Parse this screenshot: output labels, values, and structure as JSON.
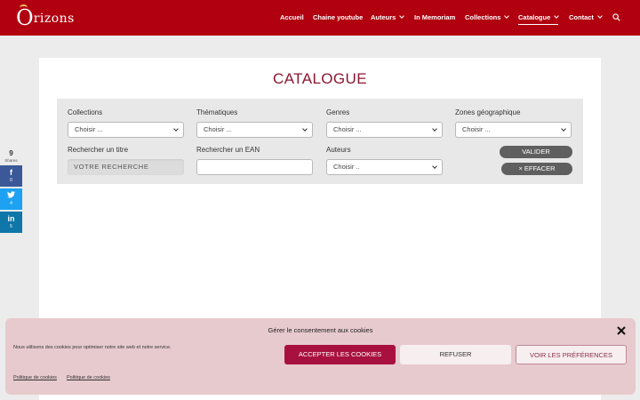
{
  "brand": {
    "logo_initial": "O",
    "logo_rest": "rizons"
  },
  "nav": {
    "items": [
      {
        "label": "Accueil"
      },
      {
        "label": "Chaine youtube"
      },
      {
        "label": "Auteurs"
      },
      {
        "label": "In Memoriam"
      },
      {
        "label": "Collections"
      },
      {
        "label": "Catalogue"
      },
      {
        "label": "Contact"
      }
    ],
    "active": "Catalogue"
  },
  "page": {
    "title": "CATALOGUE"
  },
  "filters": {
    "collections": {
      "label": "Collections",
      "value": "Choisir ..."
    },
    "thematiques": {
      "label": "Thématiques",
      "value": "Choisir ..."
    },
    "genres": {
      "label": "Genres",
      "value": "Choisir ..."
    },
    "zones": {
      "label": "Zones géographique",
      "value": "Choisir ..."
    },
    "title_search": {
      "label": "Rechercher un titre",
      "placeholder": "VOTRE RECHERCHE"
    },
    "ean_search": {
      "label": "Rechercher un EAN",
      "value": ""
    },
    "auteurs": {
      "label": "Auteurs",
      "value": "Choisir .."
    },
    "validate_label": "VALIDER",
    "clear_label": "× EFFACER"
  },
  "share": {
    "count": "9",
    "label": "Shares",
    "facebook": {
      "icon": "f",
      "count": "0"
    },
    "twitter": {
      "icon": "twitter-bird",
      "count": "4"
    },
    "linkedin": {
      "icon": "in",
      "count": "5"
    }
  },
  "cookie": {
    "title": "Gérer le consentement aux cookies",
    "text": "Nous utilisons des cookies pour optimiser notre site web et notre service.",
    "accept_label": "ACCEPTER LES COOKIES",
    "refuse_label": "REFUSER",
    "prefs_label": "VOIR LES PRÉFÉRENCES",
    "policy_link": "Politique de cookies",
    "policy_link_2": "Politique de cookies"
  },
  "colors": {
    "brand_red": "#b1000f",
    "title_color": "#8b1731",
    "accept_bg": "#a8113f",
    "cookie_bg": "#e7cace"
  }
}
